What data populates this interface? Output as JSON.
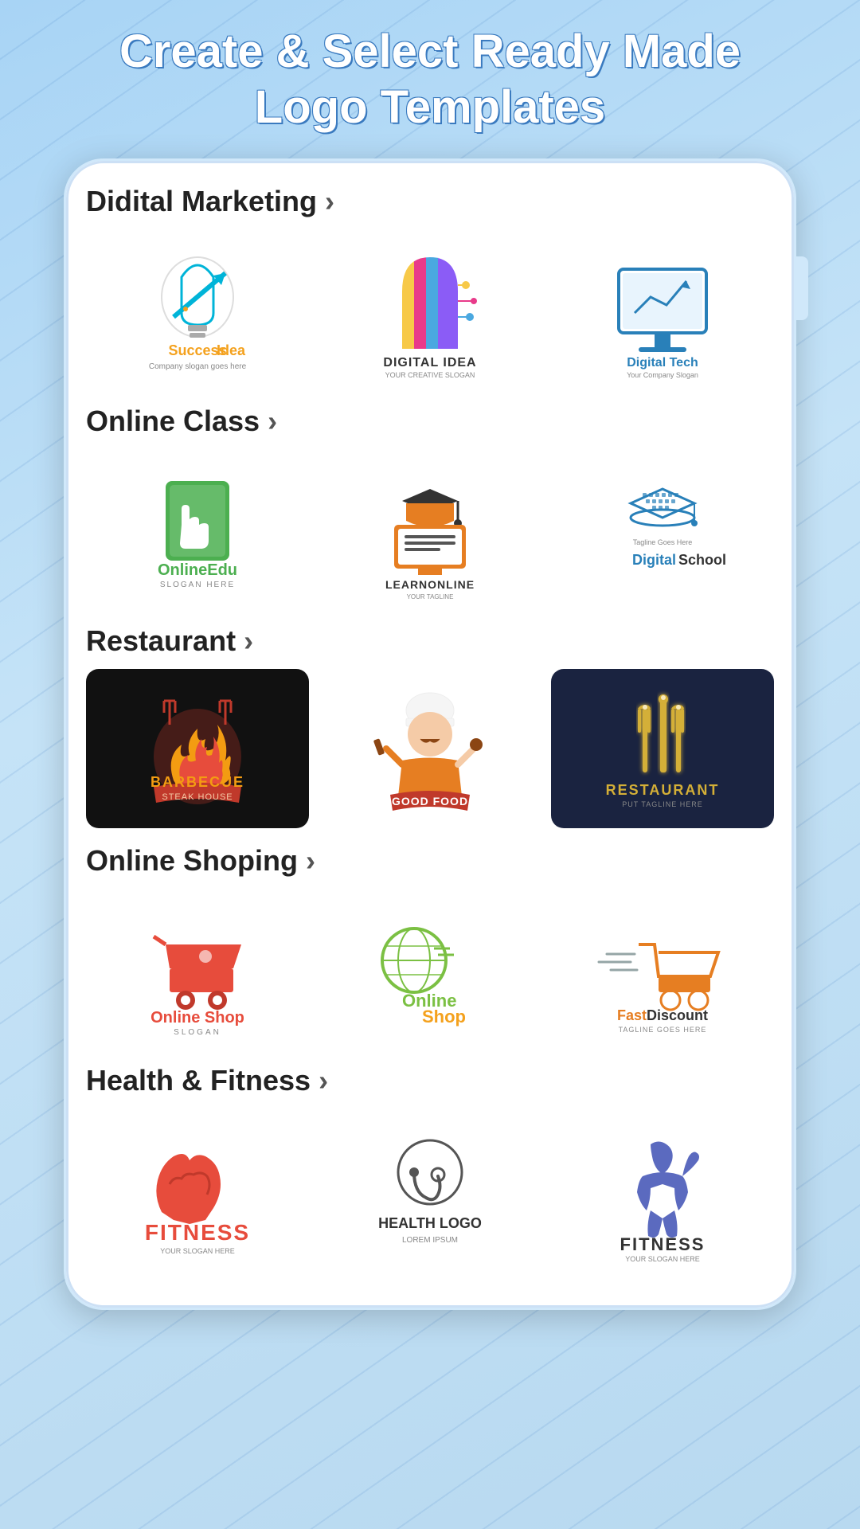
{
  "page": {
    "title_line1": "Create & Select Ready Made",
    "title_line2": "Logo Templates"
  },
  "sections": [
    {
      "id": "digital-marketing",
      "title": "Didital Marketing",
      "logos": [
        {
          "id": "success-idea",
          "type": "success-idea",
          "bg": "white"
        },
        {
          "id": "digital-idea",
          "type": "digital-idea",
          "bg": "white"
        },
        {
          "id": "digital-tech",
          "type": "digital-tech",
          "bg": "white"
        }
      ]
    },
    {
      "id": "online-class",
      "title": "Online Class",
      "logos": [
        {
          "id": "online-edu",
          "type": "online-edu",
          "bg": "white"
        },
        {
          "id": "learn-online",
          "type": "learn-online",
          "bg": "white"
        },
        {
          "id": "digital-school",
          "type": "digital-school",
          "bg": "white"
        }
      ]
    },
    {
      "id": "restaurant",
      "title": "Restaurant",
      "logos": [
        {
          "id": "barbecue",
          "type": "barbecue",
          "bg": "#111"
        },
        {
          "id": "good-food",
          "type": "good-food",
          "bg": "white"
        },
        {
          "id": "restaurant",
          "type": "restaurant",
          "bg": "#1a2340"
        }
      ]
    },
    {
      "id": "online-shoping",
      "title": "Online Shoping",
      "logos": [
        {
          "id": "online-shop1",
          "type": "online-shop1",
          "bg": "white"
        },
        {
          "id": "online-shop2",
          "type": "online-shop2",
          "bg": "white"
        },
        {
          "id": "fast-discount",
          "type": "fast-discount",
          "bg": "white"
        }
      ]
    },
    {
      "id": "health-fitness",
      "title": "Health & Fitness",
      "logos": [
        {
          "id": "fitness1",
          "type": "fitness1",
          "bg": "white"
        },
        {
          "id": "health-logo",
          "type": "health-logo",
          "bg": "white"
        },
        {
          "id": "fitness2",
          "type": "fitness2",
          "bg": "white"
        }
      ]
    }
  ]
}
